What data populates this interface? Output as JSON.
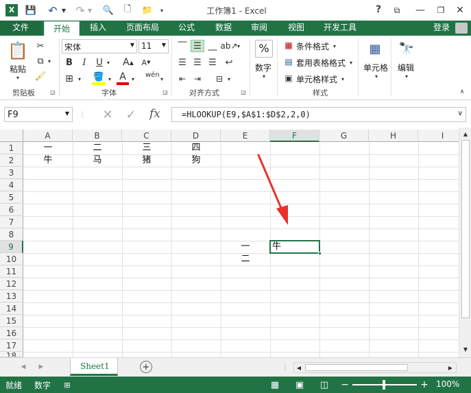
{
  "titlebar": {
    "title": "工作簿1 - Excel",
    "help": "?"
  },
  "tabs": [
    "文件",
    "开始",
    "插入",
    "页面布局",
    "公式",
    "数据",
    "审阅",
    "视图",
    "开发工具"
  ],
  "login": "登录",
  "clipboard": {
    "paste": "粘贴",
    "group": "剪贴板"
  },
  "font": {
    "name": "宋体",
    "size": "11",
    "group": "字体",
    "wen": "wén"
  },
  "alignment": {
    "group": "对齐方式"
  },
  "number": {
    "label": "数字",
    "pct": "%"
  },
  "styles": {
    "cond": "条件格式",
    "table": "套用表格格式",
    "cell": "单元格样式",
    "group": "样式"
  },
  "cells": {
    "label": "单元格"
  },
  "editing": {
    "label": "编辑"
  },
  "formula_bar": {
    "name_box": "F9",
    "formula": "=HLOOKUP(E9,$A$1:$D$2,2,0)",
    "fx": "fx"
  },
  "columns": [
    "A",
    "B",
    "C",
    "D",
    "E",
    "F",
    "G",
    "H",
    "I"
  ],
  "rows": [
    "1",
    "2",
    "3",
    "4",
    "5",
    "6",
    "7",
    "8",
    "9",
    "10",
    "11",
    "12",
    "13",
    "14",
    "15",
    "16",
    "17",
    "18"
  ],
  "cell_values": {
    "A1": "一",
    "B1": "二",
    "C1": "三",
    "D1": "四",
    "A2": "牛",
    "B2": "马",
    "C2": "猪",
    "D2": "狗",
    "E9": "一",
    "E10": "二",
    "F9": "牛"
  },
  "sheet_tab": "Sheet1",
  "statusbar": {
    "ready": "就绪",
    "mode": "数字",
    "zoom": "100%"
  },
  "colors": {
    "accent": "#217346"
  }
}
